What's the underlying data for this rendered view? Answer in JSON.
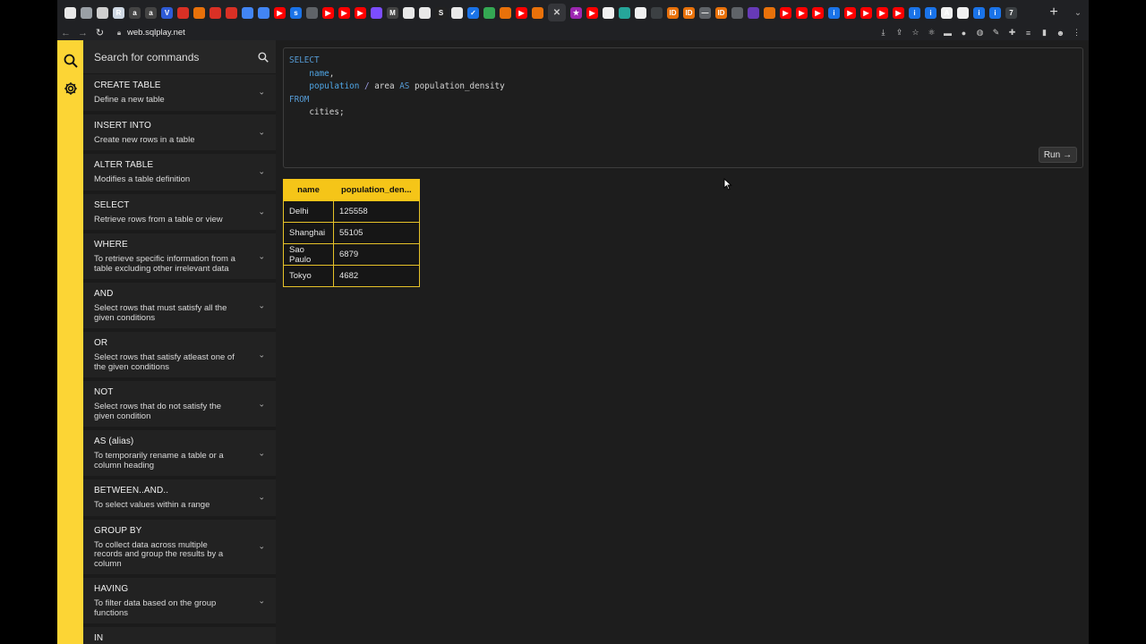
{
  "browser": {
    "url": "web.sqlplay.net",
    "new_tab_symbol": "+",
    "tab_menu_symbol": "⌄",
    "tab_favicons": [
      {
        "icon": "circle-white",
        "color": "#e8e8e8",
        "glyph": ""
      },
      {
        "icon": "globe",
        "color": "#9aa0a6",
        "glyph": ""
      },
      {
        "icon": "circle-target",
        "color": "#cfcfcf",
        "glyph": ""
      },
      {
        "icon": "r-logo",
        "color": "#cfd8e3",
        "glyph": "R"
      },
      {
        "icon": "a-logo",
        "color": "#444",
        "glyph": "a"
      },
      {
        "icon": "a-logo",
        "color": "#444",
        "glyph": "a"
      },
      {
        "icon": "v-logo",
        "color": "#2e5bd6",
        "glyph": "V"
      },
      {
        "icon": "red-box",
        "color": "#d93025",
        "glyph": ""
      },
      {
        "icon": "orange-box",
        "color": "#e8710a",
        "glyph": ""
      },
      {
        "icon": "red-box",
        "color": "#d93025",
        "glyph": ""
      },
      {
        "icon": "red-box",
        "color": "#d93025",
        "glyph": ""
      },
      {
        "icon": "blue-swirl",
        "color": "#4285f4",
        "glyph": ""
      },
      {
        "icon": "blue-swirl",
        "color": "#4285f4",
        "glyph": ""
      },
      {
        "icon": "youtube",
        "color": "#ff0000",
        "glyph": "▶"
      },
      {
        "icon": "blue-s",
        "color": "#1a73e8",
        "glyph": "s"
      },
      {
        "icon": "chart",
        "color": "#5f6368",
        "glyph": ""
      },
      {
        "icon": "youtube",
        "color": "#ff0000",
        "glyph": "▶"
      },
      {
        "icon": "youtube",
        "color": "#ff0000",
        "glyph": "▶"
      },
      {
        "icon": "youtube",
        "color": "#ff0000",
        "glyph": "▶"
      },
      {
        "icon": "circle-purple",
        "color": "#7c4dff",
        "glyph": ""
      },
      {
        "icon": "gmail",
        "color": "#444",
        "glyph": "M"
      },
      {
        "icon": "doc",
        "color": "#e8e8e8",
        "glyph": ""
      },
      {
        "icon": "leaf",
        "color": "#e8e8e8",
        "glyph": ""
      },
      {
        "icon": "s-logo",
        "color": "#222",
        "glyph": "S"
      },
      {
        "icon": "cube",
        "color": "#e8e8e8",
        "glyph": ""
      },
      {
        "icon": "check",
        "color": "#1a73e8",
        "glyph": "✓"
      },
      {
        "icon": "green-pin",
        "color": "#34a853",
        "glyph": ""
      },
      {
        "icon": "orange-box",
        "color": "#e8710a",
        "glyph": ""
      },
      {
        "icon": "youtube",
        "color": "#ff0000",
        "glyph": "▶"
      },
      {
        "icon": "orange-box",
        "color": "#e8710a",
        "glyph": ""
      },
      {
        "icon": "close",
        "color": "#35363a",
        "glyph": "✕",
        "active": true
      },
      {
        "icon": "star",
        "color": "#9c27b0",
        "glyph": "★"
      },
      {
        "icon": "youtube",
        "color": "#ff0000",
        "glyph": "▶"
      },
      {
        "icon": "github",
        "color": "#f0f0f0",
        "glyph": ""
      },
      {
        "icon": "teal-box",
        "color": "#26a69a",
        "glyph": ""
      },
      {
        "icon": "github",
        "color": "#f0f0f0",
        "glyph": ""
      },
      {
        "icon": "dark-box",
        "color": "#3c4043",
        "glyph": ""
      },
      {
        "icon": "id-logo",
        "color": "#e8710a",
        "glyph": "ID"
      },
      {
        "icon": "id-logo",
        "color": "#e8710a",
        "glyph": "ID"
      },
      {
        "icon": "dash",
        "color": "#5f6368",
        "glyph": "—"
      },
      {
        "icon": "id-logo",
        "color": "#e8710a",
        "glyph": "ID"
      },
      {
        "icon": "globe",
        "color": "#5f6368",
        "glyph": ""
      },
      {
        "icon": "purple-box",
        "color": "#673ab7",
        "glyph": ""
      },
      {
        "icon": "orange-box",
        "color": "#e8710a",
        "glyph": ""
      },
      {
        "icon": "youtube",
        "color": "#ff0000",
        "glyph": "▶"
      },
      {
        "icon": "youtube",
        "color": "#ff0000",
        "glyph": "▶"
      },
      {
        "icon": "youtube",
        "color": "#ff0000",
        "glyph": "▶"
      },
      {
        "icon": "info",
        "color": "#1a73e8",
        "glyph": "i"
      },
      {
        "icon": "youtube",
        "color": "#ff0000",
        "glyph": "▶"
      },
      {
        "icon": "youtube",
        "color": "#ff0000",
        "glyph": "▶"
      },
      {
        "icon": "youtube",
        "color": "#ff0000",
        "glyph": "▶"
      },
      {
        "icon": "youtube",
        "color": "#ff0000",
        "glyph": "▶"
      },
      {
        "icon": "info",
        "color": "#1a73e8",
        "glyph": "i"
      },
      {
        "icon": "info",
        "color": "#1a73e8",
        "glyph": "i"
      },
      {
        "icon": "a-logo",
        "color": "#f0f0f0",
        "glyph": "A"
      },
      {
        "icon": "github",
        "color": "#f0f0f0",
        "glyph": ""
      },
      {
        "icon": "info",
        "color": "#1a73e8",
        "glyph": "i"
      },
      {
        "icon": "info",
        "color": "#1a73e8",
        "glyph": "i"
      },
      {
        "icon": "seven",
        "color": "#3c4043",
        "glyph": "7"
      }
    ],
    "toolbar_icons": [
      {
        "name": "install-icon",
        "glyph": "⤓"
      },
      {
        "name": "share-icon",
        "glyph": "⇪"
      },
      {
        "name": "bookmark-star-icon",
        "glyph": "☆"
      },
      {
        "name": "extension-react-icon",
        "glyph": "⚛"
      },
      {
        "name": "extension-red-icon",
        "glyph": "▬"
      },
      {
        "name": "extension-circle-icon",
        "glyph": "●"
      },
      {
        "name": "extension-gray-icon",
        "glyph": "◍"
      },
      {
        "name": "extension-pen-icon",
        "glyph": "✎"
      },
      {
        "name": "extensions-puzzle-icon",
        "glyph": "✚"
      },
      {
        "name": "reading-list-icon",
        "glyph": "≡"
      },
      {
        "name": "side-panel-icon",
        "glyph": "▮"
      },
      {
        "name": "profile-avatar-icon",
        "glyph": "☻"
      },
      {
        "name": "kebab-menu-icon",
        "glyph": "⋮"
      }
    ]
  },
  "sidebar": {
    "search_placeholder": "Search for commands",
    "commands": [
      {
        "title": "CREATE TABLE",
        "desc": "Define a new table"
      },
      {
        "title": "INSERT INTO",
        "desc": "Create new rows in a table"
      },
      {
        "title": "ALTER TABLE",
        "desc": "Modifies a table definition"
      },
      {
        "title": "SELECT",
        "desc": "Retrieve rows from a table or view"
      },
      {
        "title": "WHERE",
        "desc": "To retrieve specific information from a table excluding other irrelevant data"
      },
      {
        "title": "AND",
        "desc": "Select rows that must satisfy all the given conditions"
      },
      {
        "title": "OR",
        "desc": "Select rows that satisfy atleast one of the given conditions"
      },
      {
        "title": "NOT",
        "desc": "Select rows that do not satisfy the given condition"
      },
      {
        "title": "AS (alias)",
        "desc": "To temporarily rename a table or a column heading"
      },
      {
        "title": "BETWEEN..AND..",
        "desc": "To select values within a range"
      },
      {
        "title": "GROUP BY",
        "desc": "To collect data across multiple records and group the results by a column"
      },
      {
        "title": "HAVING",
        "desc": "To filter data based on the group functions"
      },
      {
        "title": "IN",
        "desc": ""
      }
    ]
  },
  "editor": {
    "lines": [
      [
        {
          "t": "SELECT",
          "c": "kw"
        }
      ],
      [
        {
          "t": "    "
        },
        {
          "t": "name",
          "c": "col"
        },
        {
          "t": ","
        }
      ],
      [
        {
          "t": "    "
        },
        {
          "t": "population",
          "c": "col"
        },
        {
          "t": " "
        },
        {
          "t": "/",
          "c": "op"
        },
        {
          "t": " area "
        },
        {
          "t": "AS",
          "c": "kw"
        },
        {
          "t": " population_density"
        }
      ],
      [
        {
          "t": "FROM",
          "c": "kw"
        }
      ],
      [
        {
          "t": "    cities;"
        }
      ]
    ],
    "run_label": "Run",
    "run_icon": "→"
  },
  "result": {
    "columns": [
      "name",
      "population_den..."
    ],
    "rows": [
      [
        "Delhi",
        "125558"
      ],
      [
        "Shanghai",
        "55105"
      ],
      [
        "Sao Paulo",
        "6879"
      ],
      [
        "Tokyo",
        "4682"
      ]
    ]
  }
}
